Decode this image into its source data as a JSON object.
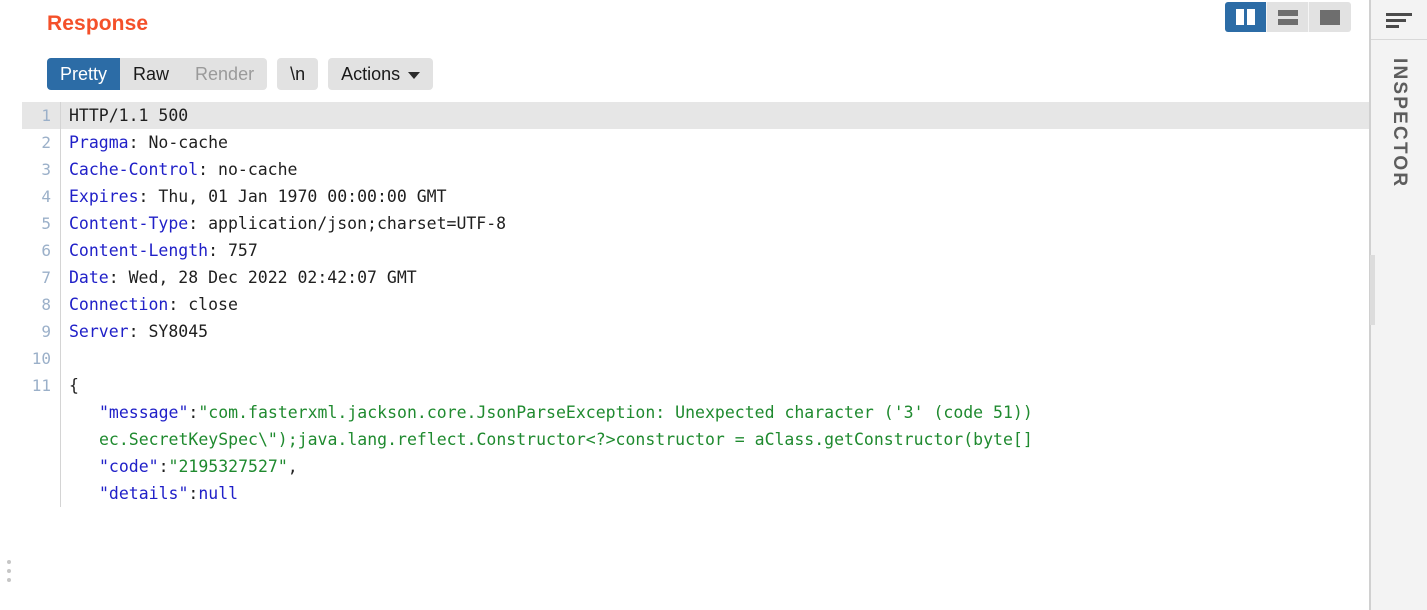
{
  "panel": {
    "title": "Response"
  },
  "layout_toggles": [
    {
      "name": "vertical-split",
      "icon": "columns-icon",
      "selected": true
    },
    {
      "name": "horizontal-split",
      "icon": "rows-icon",
      "selected": false
    },
    {
      "name": "single-pane",
      "icon": "square-icon",
      "selected": false
    }
  ],
  "tabs": [
    {
      "label": "Pretty",
      "state": "selected"
    },
    {
      "label": "Raw",
      "state": "normal"
    },
    {
      "label": "Render",
      "state": "disabled"
    }
  ],
  "buttons": {
    "newline": "\\n",
    "actions": "Actions",
    "actions_chevron": "chevron-down-icon"
  },
  "inspector": {
    "label": "INSPECTOR",
    "icon": "text-align-icon"
  },
  "colors": {
    "title": "#f4502a",
    "accent": "#2c6ca6",
    "header_name": "#2020c8",
    "json_string": "#1f8a2f",
    "json_key": "#2020c8",
    "gutter": "#9bb0c9",
    "highlight_row": "#e6e6e6",
    "pill_bg": "#e2e2e2"
  },
  "response": {
    "status_line": "HTTP/1.1 500",
    "headers": [
      {
        "name": "Pragma",
        "value": "No-cache"
      },
      {
        "name": "Cache-Control",
        "value": "no-cache"
      },
      {
        "name": "Expires",
        "value": "Thu, 01 Jan 1970 00:00:00 GMT"
      },
      {
        "name": "Content-Type",
        "value": "application/json;charset=UTF-8"
      },
      {
        "name": "Content-Length",
        "value": "757"
      },
      {
        "name": "Date",
        "value": "Wed, 28 Dec 2022 02:42:07 GMT"
      },
      {
        "name": "Connection",
        "value": "close"
      },
      {
        "name": "Server",
        "value": "SY8045"
      }
    ],
    "body": {
      "open_brace": "{",
      "message_key": "\"message\"",
      "message_value_line1": "\"com.fasterxml.jackson.core.JsonParseException: Unexpected character ('3' (code 51))",
      "message_value_line2": "ec.SecretKeySpec\\\");java.lang.reflect.Constructor<?>constructor = aClass.getConstructor(byte[]",
      "code_key": "\"code\"",
      "code_value": "\"2195327527\"",
      "code_comma": ",",
      "details_key": "\"details\"",
      "details_value": "null"
    },
    "line_numbers": [
      "1",
      "2",
      "3",
      "4",
      "5",
      "6",
      "7",
      "8",
      "9",
      "10",
      "11"
    ]
  }
}
